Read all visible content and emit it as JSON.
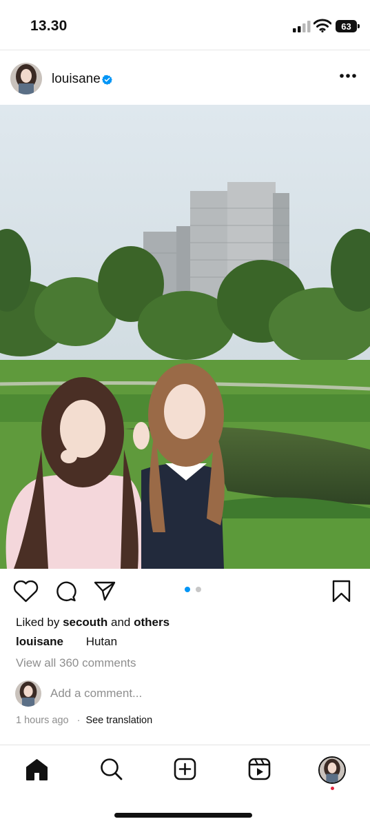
{
  "status_bar": {
    "time": "13.30",
    "battery": "63"
  },
  "post": {
    "username": "louisane",
    "verified": true,
    "more_icon": "more-horizontal-icon",
    "photo_alt": "park-with-two-women-photo",
    "carousel": {
      "count": 2,
      "active": 1
    },
    "liked_by_prefix": "Liked by",
    "liked_by_user": "secouth",
    "liked_by_and": "and",
    "liked_by_others": "others",
    "caption_user": "louisane",
    "caption_text": "Hutan",
    "view_comments": "View all 360 comments",
    "add_comment_placeholder": "Add a comment...",
    "time_ago": "1 hours ago",
    "separator": "·",
    "see_translation": "See translation"
  },
  "actions": [
    "heart-icon",
    "comment-icon",
    "share-icon",
    "bookmark-icon"
  ],
  "bottom_nav": [
    "home-icon",
    "search-icon",
    "create-icon",
    "reels-icon",
    "profile-avatar"
  ],
  "colors": {
    "accent": "#0095f6",
    "notification": "#e0243f",
    "muted": "#8e8e8e"
  }
}
